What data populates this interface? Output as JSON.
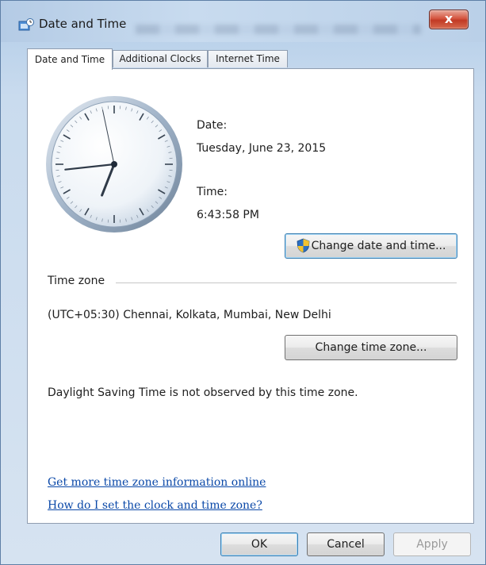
{
  "window": {
    "title": "Date and Time",
    "close_glyph": "x"
  },
  "tabs": [
    {
      "label": "Date and Time",
      "active": true
    },
    {
      "label": "Additional Clocks",
      "active": false
    },
    {
      "label": "Internet Time",
      "active": false
    }
  ],
  "datetime": {
    "date_label": "Date:",
    "date_value": "Tuesday, June 23, 2015",
    "time_label": "Time:",
    "time_value": "6:43:58 PM",
    "change_button": "Change date and time..."
  },
  "clock": {
    "hour": 18,
    "minute": 43,
    "second": 58
  },
  "timezone": {
    "section_label": "Time zone",
    "value": "(UTC+05:30) Chennai, Kolkata, Mumbai, New Delhi",
    "change_button": "Change time zone...",
    "dst_note": "Daylight Saving Time is not observed by this time zone."
  },
  "links": {
    "more_info": "Get more time zone information online",
    "how_to": "How do I set the clock and time zone?"
  },
  "footer": {
    "ok": "OK",
    "cancel": "Cancel",
    "apply": "Apply"
  },
  "colors": {
    "link": "#0a48a8",
    "close": "#c13a25",
    "shield_blue": "#2b6fc2",
    "shield_yellow": "#f2c230"
  },
  "icons": {
    "app": "date-time-control-panel-icon",
    "uac": "uac-shield-icon",
    "close": "close-icon"
  }
}
